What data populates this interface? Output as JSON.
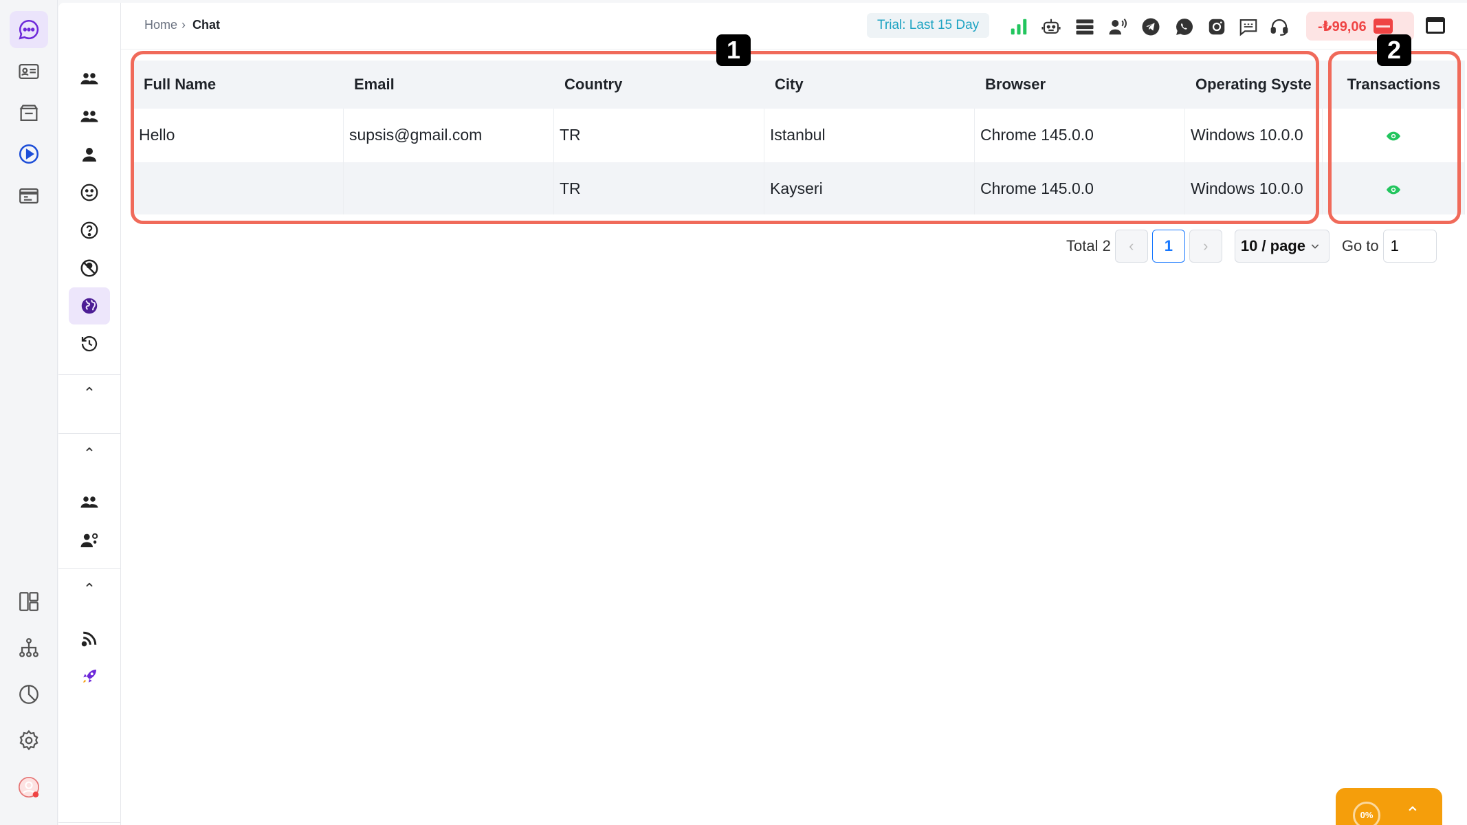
{
  "breadcrumb": {
    "home": "Home",
    "separator": "›",
    "current": "Chat"
  },
  "topbar": {
    "trial_label": "Trial: Last 15 Day",
    "balance": "-₺99,06",
    "icons": [
      "signal-icon",
      "bot-icon",
      "list-icon",
      "voice-icon",
      "telegram-icon",
      "whatsapp-icon",
      "instagram-icon",
      "sms-icon",
      "support-icon"
    ]
  },
  "table": {
    "headers": [
      "Full Name",
      "Email",
      "Country",
      "City",
      "Browser",
      "Operating Syste",
      "Transactions"
    ],
    "rows": [
      {
        "full_name": "Hello",
        "email": "supsis@gmail.com",
        "country": "TR",
        "city": "Istanbul",
        "browser": "Chrome 145.0.0",
        "os": "Windows 10.0.0"
      },
      {
        "full_name": "",
        "email": "",
        "country": "TR",
        "city": "Kayseri",
        "browser": "Chrome 145.0.0",
        "os": "Windows 10.0.0"
      }
    ]
  },
  "annotations": {
    "tag1": "1",
    "tag2": "2"
  },
  "pagination": {
    "total": "Total 2",
    "prev": "‹",
    "current_page": "1",
    "next": "›",
    "page_size": "10 / page",
    "goto_label": "Go to",
    "goto_value": "1"
  },
  "progress": {
    "percent": "0%",
    "arrow": "⌃"
  },
  "side_collapse": "⌃",
  "colors": {
    "accent": "#7c3aed",
    "highlight": "#f06a5a",
    "trial": "#1ca3c2",
    "danger": "#ef4444",
    "eye": "#22c55e"
  }
}
